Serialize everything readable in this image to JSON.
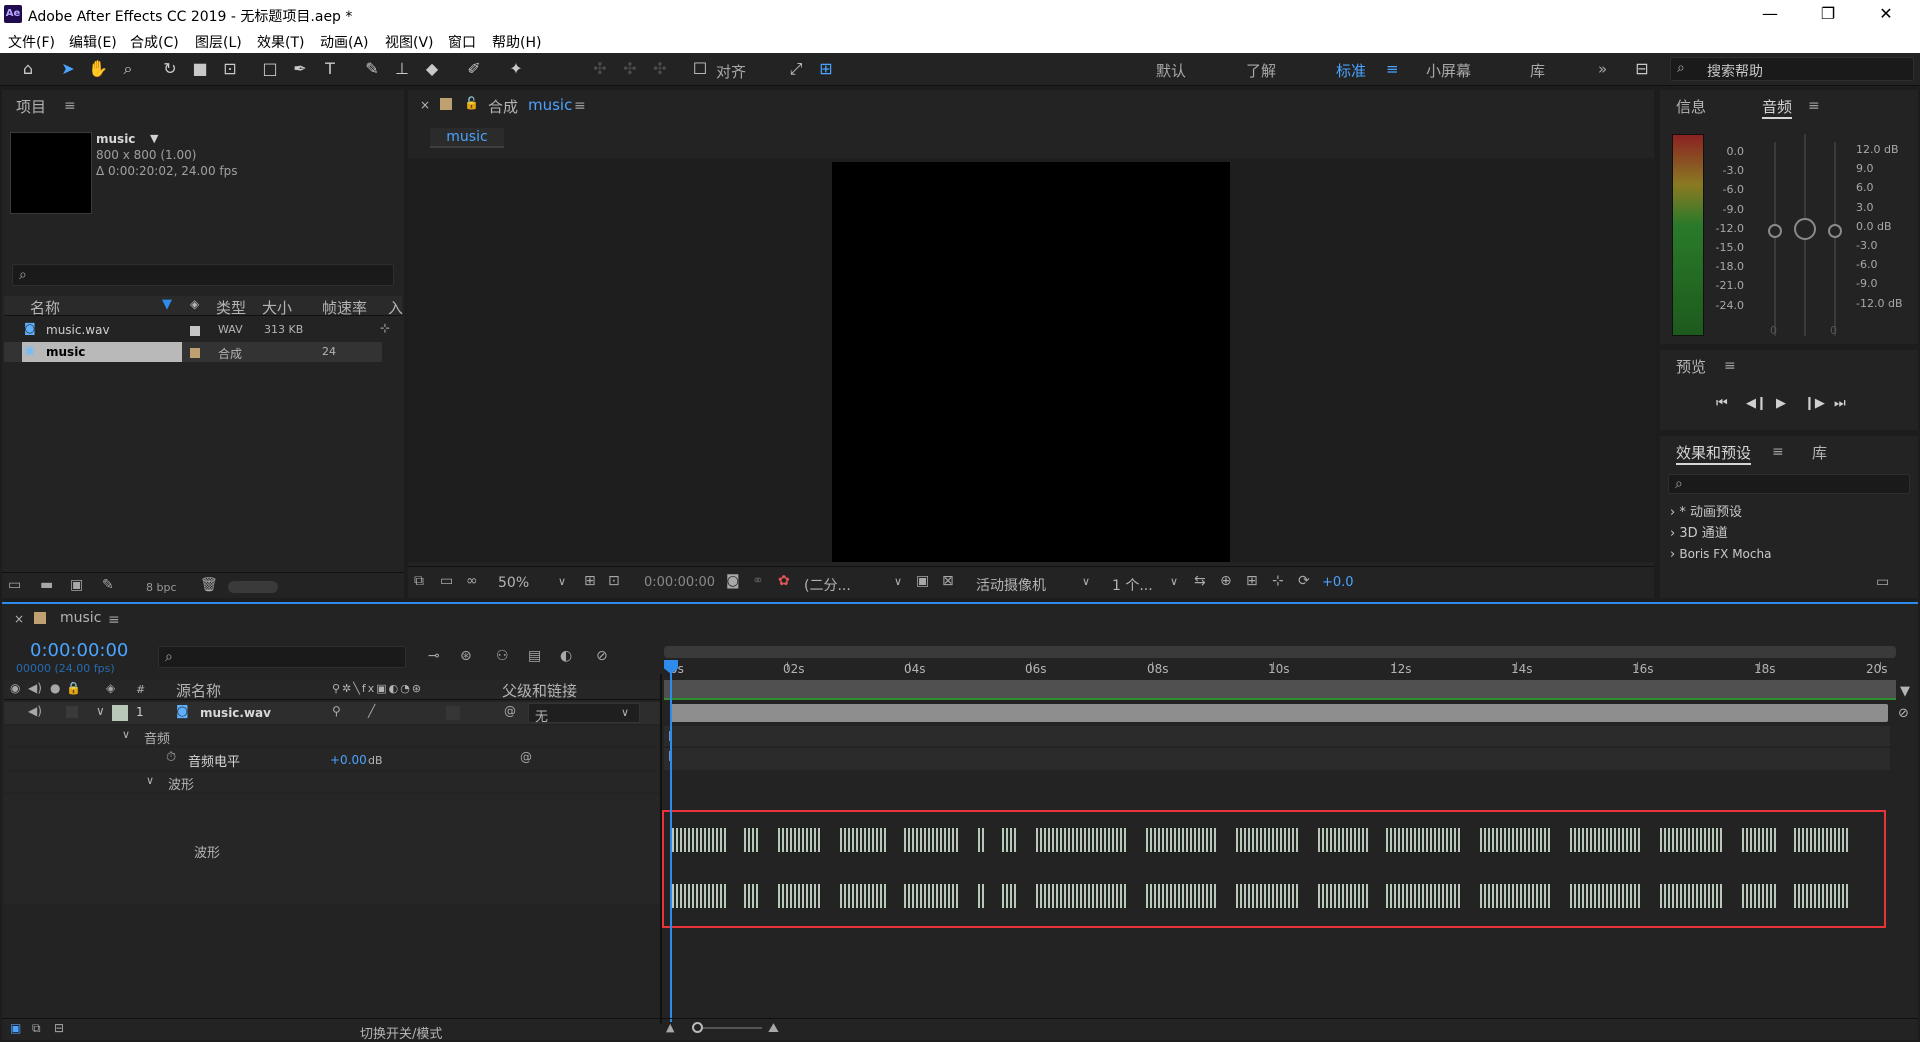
{
  "window": {
    "title": "Adobe After Effects CC 2019 - 无标题项目.aep *",
    "logo": "Ae"
  },
  "menu": [
    "文件(F)",
    "编辑(E)",
    "合成(C)",
    "图层(L)",
    "效果(T)",
    "动画(A)",
    "视图(V)",
    "窗口",
    "帮助(H)"
  ],
  "toolbar": {
    "snap_label": "对齐",
    "workspaces": [
      "默认",
      "了解",
      "标准",
      "小屏幕",
      "库"
    ],
    "search_placeholder": "搜索帮助"
  },
  "project": {
    "tab": "项目",
    "preview_name": "music",
    "preview_dims": "800 x 800 (1.00)",
    "preview_dur": "Δ 0:00:20:02, 24.00 fps",
    "columns": [
      "名称",
      "类型",
      "大小",
      "帧速率",
      "入"
    ],
    "items": [
      {
        "name": "music.wav",
        "type": "WAV",
        "size": "313 KB",
        "fps": ""
      },
      {
        "name": "music",
        "type": "合成",
        "size": "",
        "fps": "24"
      }
    ],
    "bpc": "8 bpc"
  },
  "composition": {
    "tab_prefix": "合成",
    "tab_name": "music",
    "subtab": "music",
    "zoom": "50%",
    "timecode": "0:00:00:00",
    "resolution": "(二分...",
    "camera": "活动摄像机",
    "views": "1 个...",
    "exposure": "+0.0"
  },
  "info_panel": {
    "tab_info": "信息",
    "tab_audio": "音频",
    "left_scale": [
      "0.0",
      "-3.0",
      "-6.0",
      "-9.0",
      "-12.0",
      "-15.0",
      "-18.0",
      "-21.0",
      "-24.0"
    ],
    "right_scale": [
      "12.0 dB",
      "9.0",
      "6.0",
      "3.0",
      "0.0 dB",
      "-3.0",
      "-6.0",
      "-9.0",
      "-12.0 dB"
    ],
    "zero_left": "0",
    "zero_right": "0"
  },
  "preview_panel": {
    "tab": "预览"
  },
  "effects_panel": {
    "tab": "效果和预设",
    "tab_lib": "库",
    "items": [
      "* 动画预设",
      "3D 通道",
      "Boris FX Mocha"
    ]
  },
  "timeline": {
    "tab": "music",
    "timecode": "0:00:00:00",
    "frame_info": "00000 (24.00 fps)",
    "ruler": [
      "0s",
      "02s",
      "04s",
      "06s",
      "08s",
      "10s",
      "12s",
      "14s",
      "16s",
      "18s",
      "20s"
    ],
    "col_hash": "#",
    "col_source": "源名称",
    "col_parent": "父级和链接",
    "layer": {
      "num": "1",
      "name": "music.wav",
      "parent": "无"
    },
    "audio_group": "音频",
    "audio_level_label": "音频电平",
    "audio_level_value": "+0.00",
    "audio_level_unit": "dB",
    "waveform_group": "波形",
    "waveform_label": "波形",
    "footer_toggle": "切换开关/模式"
  },
  "colors": {
    "accent": "#2d8ceb",
    "highlight_box": "#e8333a",
    "waveform": "#b8c8b9"
  }
}
